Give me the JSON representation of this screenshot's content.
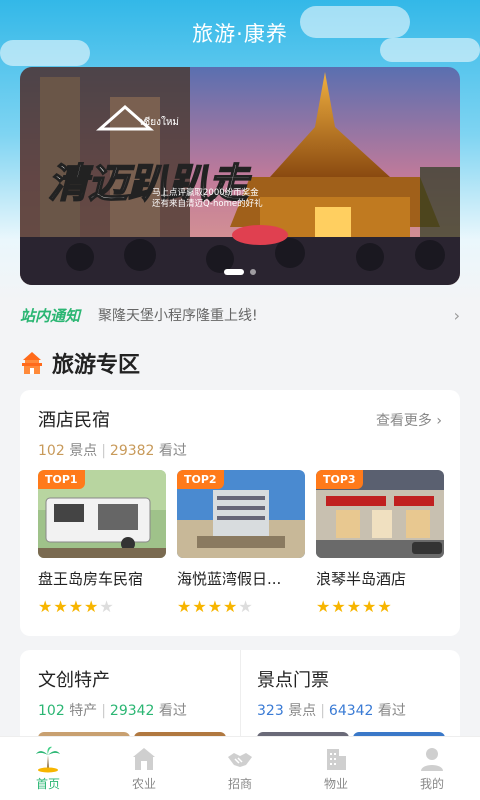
{
  "header": {
    "title": "旅游·康养"
  },
  "banner": {
    "headline": "清迈趴趴走",
    "logo_text": "เชียงใหม่",
    "promo_line1": "马上点评赢取2000纷币奖金",
    "promo_line2": "还有来自清迈Q-home的好礼"
  },
  "notice": {
    "tag": "站内通知",
    "text": "聚隆天堡小程序隆重上线!",
    "arrow": "›"
  },
  "section": {
    "title": "旅游专区",
    "icon": "temple-icon"
  },
  "hotels": {
    "title": "酒店民宿",
    "more": "查看更多 ›",
    "count": "102",
    "count_unit": "景点",
    "views": "29382",
    "views_unit": "看过",
    "items": [
      {
        "badge": "TOP1",
        "name": "盘王岛房车民宿",
        "rating": 4.5
      },
      {
        "badge": "TOP2",
        "name": "海悦蓝湾假日...",
        "rating": 4.5
      },
      {
        "badge": "TOP3",
        "name": "浪琴半岛酒店",
        "rating": 5
      }
    ]
  },
  "culture": {
    "title": "文创特产",
    "count": "102",
    "count_unit": "特产",
    "views": "29342",
    "views_unit": "看过"
  },
  "tickets": {
    "title": "景点门票",
    "count": "323",
    "count_unit": "景点",
    "views": "64342",
    "views_unit": "看过"
  },
  "tabbar": [
    {
      "label": "首页",
      "icon": "palm-tree-icon",
      "active": true
    },
    {
      "label": "农业",
      "icon": "barn-icon",
      "active": false
    },
    {
      "label": "招商",
      "icon": "handshake-icon",
      "active": false
    },
    {
      "label": "物业",
      "icon": "building-icon",
      "active": false
    },
    {
      "label": "我的",
      "icon": "user-icon",
      "active": false
    }
  ],
  "colors": {
    "accent": "#2bb673",
    "badge": "#ff7a1a",
    "star": "#f7b500",
    "sky": "#33b8e8"
  }
}
